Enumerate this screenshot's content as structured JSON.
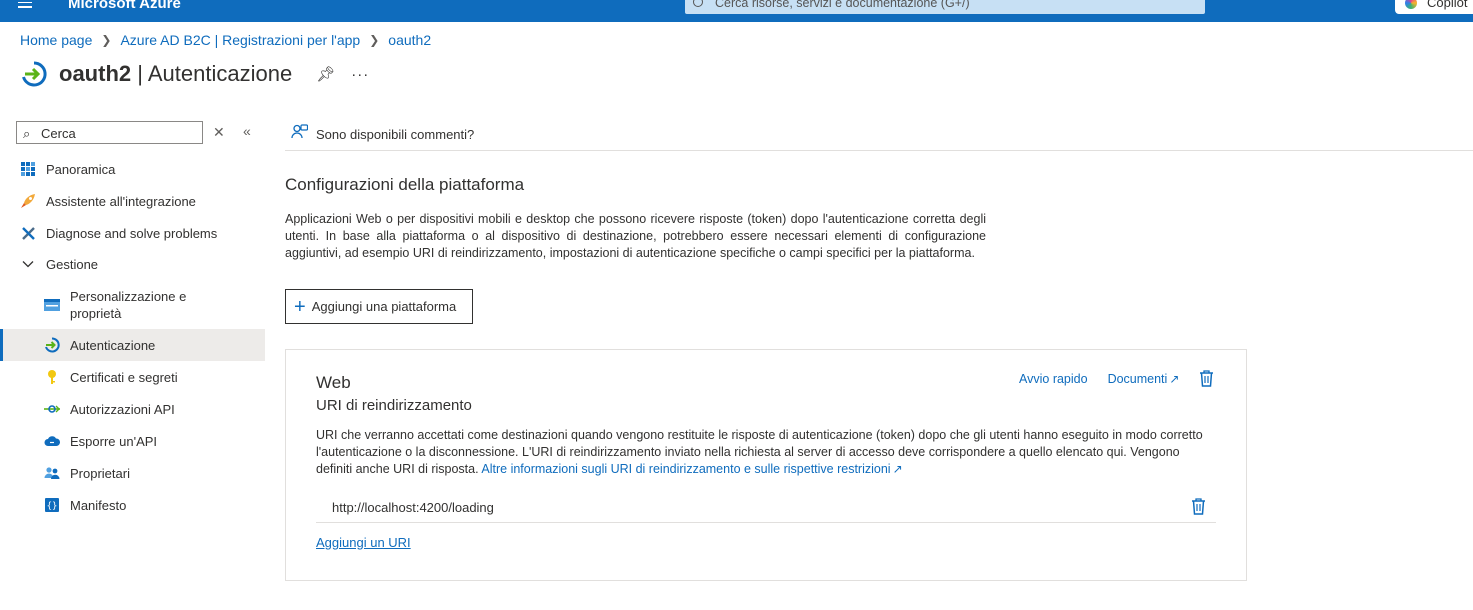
{
  "topbar": {
    "brand": "Microsoft Azure",
    "search_placeholder": "Cerca risorse, servizi e documentazione (G+/)",
    "copilot_label": "Copilot"
  },
  "breadcrumb": [
    "Home page",
    "Azure AD B2C | Registrazioni per l'app",
    "oauth2"
  ],
  "page": {
    "title_app": "oauth2",
    "title_sep": " | ",
    "title_section": "Autenticazione"
  },
  "sidebar": {
    "search_placeholder": "Cerca",
    "items": [
      {
        "label": "Panoramica",
        "icon": "grid-icon"
      },
      {
        "label": "Assistente all'integrazione",
        "icon": "rocket-icon"
      },
      {
        "label": "Diagnose and solve problems",
        "icon": "wrench-icon"
      },
      {
        "label": "Gestione",
        "icon": "chevron-down-icon"
      },
      {
        "label": "Personalizzazione e proprietà",
        "icon": "branding-icon"
      },
      {
        "label": "Autenticazione",
        "icon": "auth-icon"
      },
      {
        "label": "Certificati e segreti",
        "icon": "key-icon"
      },
      {
        "label": "Autorizzazioni API",
        "icon": "api-permissions-icon"
      },
      {
        "label": "Esporre un'API",
        "icon": "cloud-icon"
      },
      {
        "label": "Proprietari",
        "icon": "people-icon"
      },
      {
        "label": "Manifesto",
        "icon": "manifest-icon"
      }
    ]
  },
  "main": {
    "feedback": "Sono disponibili commenti?",
    "section_title": "Configurazioni della piattaforma",
    "section_desc": "Applicazioni Web o per dispositivi mobili e desktop che possono ricevere risposte (token) dopo l'autenticazione corretta degli utenti. In base alla piattaforma o al dispositivo di destinazione, potrebbero essere necessari elementi di configurazione aggiuntivi, ad esempio URI di reindirizzamento, impostazioni di autenticazione specifiche o campi specifici per la piattaforma.",
    "add_platform": "Aggiungi una piattaforma"
  },
  "card": {
    "title": "Web",
    "subtitle": "URI di reindirizzamento",
    "quickstart": "Avvio rapido",
    "docs": "Documenti",
    "desc": "URI che verranno accettati come destinazioni quando vengono restituite le risposte di autenticazione (token) dopo che gli utenti hanno eseguito in modo corretto l'autenticazione o la disconnessione. L'URI di reindirizzamento inviato nella richiesta al server di accesso deve corrispondere a quello elencato qui. Vengono definiti anche URI di risposta.",
    "desc_link": "Altre informazioni sugli URI di reindirizzamento e sulle rispettive restrizioni",
    "uri": "http://localhost:4200/loading",
    "add_uri": "Aggiungi un URI"
  },
  "colors": {
    "accent": "#0f6cbd",
    "topbar": "#0f6cbd"
  }
}
